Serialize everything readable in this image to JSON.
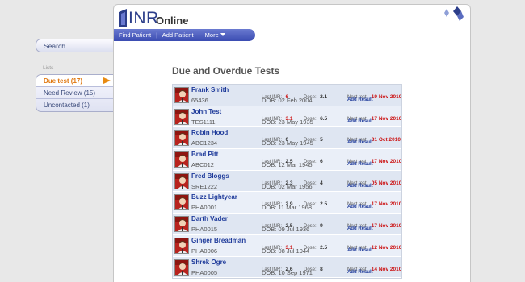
{
  "app": {
    "logo_main": "INR",
    "logo_sub": "Online"
  },
  "menu": {
    "items": [
      "Find Patient",
      "Add Patient",
      "More"
    ],
    "separator": "|"
  },
  "sidebar": {
    "search_label": "Search",
    "lists_label": "Lists",
    "lists": [
      {
        "label": "Due test (17)",
        "active": true
      },
      {
        "label": "Need Review (15)",
        "active": false
      },
      {
        "label": "Uncontacted (1)",
        "active": false
      }
    ]
  },
  "main": {
    "title": "Due and Overdue Tests",
    "labels": {
      "last_inr": "Last INR:",
      "dose": "Dose:",
      "next_test": "Next test:",
      "add_result": "Add Result",
      "dob": "DOB:"
    },
    "patients": [
      {
        "name": "Frank Smith",
        "id": "65436",
        "last_inr": "6",
        "inr_alert": true,
        "dose": "2.1",
        "dob": "02 Feb 2004",
        "next_test": "19 Nov 2010"
      },
      {
        "name": "John Test",
        "id": "TES1111",
        "last_inr": "3.1",
        "inr_alert": true,
        "dose": "6.5",
        "dob": "23 May 1935",
        "next_test": "17 Nov 2010"
      },
      {
        "name": "Robin Hood",
        "id": "ABC1234",
        "last_inr": "0",
        "inr_alert": false,
        "dose": "5",
        "dob": "23 May 1945",
        "next_test": "31 Oct 2010"
      },
      {
        "name": "Brad Pitt",
        "id": "ABC012",
        "last_inr": "2.5",
        "inr_alert": false,
        "dose": "6",
        "dob": "12 Mar 1945",
        "next_test": "17 Nov 2010"
      },
      {
        "name": "Fred Bloggs",
        "id": "SRE1222",
        "last_inr": "2.3",
        "inr_alert": false,
        "dose": "4",
        "dob": "02 Mar 1956",
        "next_test": "05 Nov 2010"
      },
      {
        "name": "Buzz Lightyear",
        "id": "PHA0001",
        "last_inr": "2.9",
        "inr_alert": false,
        "dose": "2.5",
        "dob": "11 Mar 1968",
        "next_test": "17 Nov 2010"
      },
      {
        "name": "Darth Vader",
        "id": "PHA0015",
        "last_inr": "2.5",
        "inr_alert": false,
        "dose": "9",
        "dob": "09 Jul 1936",
        "next_test": "17 Nov 2010"
      },
      {
        "name": "Ginger Breadman",
        "id": "PHA0006",
        "last_inr": "3.1",
        "inr_alert": true,
        "dose": "2.5",
        "dob": "08 Jul 1944",
        "next_test": "12 Nov 2010"
      },
      {
        "name": "Shrek Ogre",
        "id": "PHA0005",
        "last_inr": "2.6",
        "inr_alert": false,
        "dose": "8",
        "dob": "10 Sep 1971",
        "next_test": "14 Nov 2010"
      }
    ]
  },
  "colors": {
    "accent": "#3b4cb2",
    "link": "#1e3a9a",
    "alert": "#cc1111",
    "active_list": "#e07810"
  },
  "icons": {
    "logo": "logo-icon",
    "corner": "logo-mark-icon",
    "active_arrow": "arrow-right-icon",
    "avatar": "patient-photo"
  }
}
